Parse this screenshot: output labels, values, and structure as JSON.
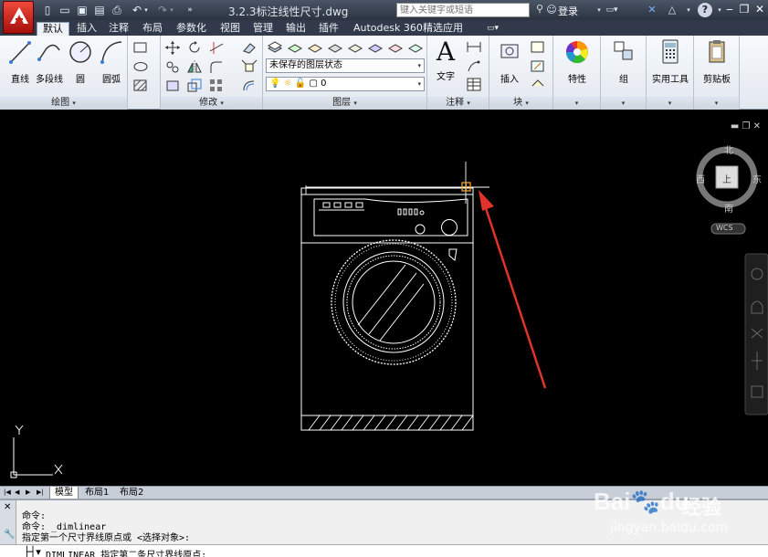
{
  "titlebar": {
    "doc_title": "3.2.3标注线性尺寸.dwg",
    "search_placeholder": "键入关键字或短语",
    "login": "登录"
  },
  "tabs": [
    "默认",
    "插入",
    "注释",
    "布局",
    "参数化",
    "视图",
    "管理",
    "输出",
    "插件",
    "Autodesk 360",
    "精选应用"
  ],
  "active_tab": "默认",
  "ribbon": {
    "draw": {
      "label": "绘图",
      "line": "直线",
      "polyline": "多段线",
      "circle": "圆",
      "arc": "圆弧"
    },
    "modify": {
      "label": "修改"
    },
    "layers": {
      "label": "图层",
      "state": "未保存的图层状态",
      "current": "0"
    },
    "annotation": {
      "label": "注释",
      "text": "文字"
    },
    "block": {
      "label": "块",
      "insert": "插入"
    },
    "properties": {
      "label": "特性"
    },
    "group": {
      "label": "组"
    },
    "utilities": {
      "label": "实用工具"
    },
    "clipboard": {
      "label": "剪贴板"
    }
  },
  "viewcube": {
    "north": "北",
    "south": "南",
    "east": "东",
    "west": "西",
    "top": "上",
    "wcs": "WCS"
  },
  "ucs": {
    "x": "X",
    "y": "Y"
  },
  "layout_tabs": [
    "模型",
    "布局1",
    "布局2"
  ],
  "active_layout": "模型",
  "command": {
    "line1": "命令:",
    "line2": "命令:  _dimlinear",
    "line3": "指定第一个尺寸界线原点或 <选择对象>:",
    "prompt": "DIMLINEAR 指定第二条尺寸界线原点:"
  },
  "watermark": {
    "brand": "Bai",
    "brand2": "du",
    "word": "经验",
    "url": "jingyan.baidu.com"
  },
  "colors": {
    "accent_red": "#e0342a",
    "ribbon_bg": "#e9edf3",
    "titlebar_bg": "#3a4352",
    "canvas": "#000000"
  }
}
